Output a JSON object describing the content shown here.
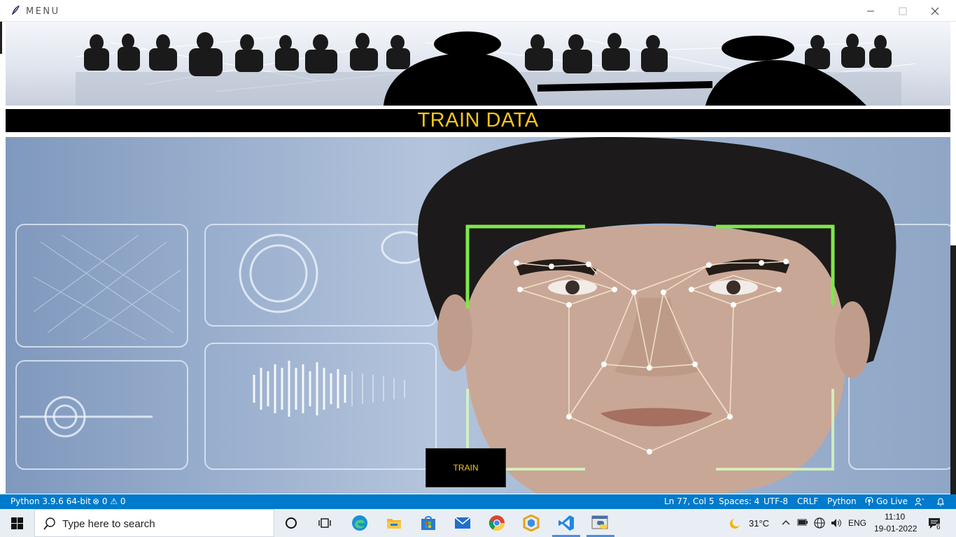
{
  "window": {
    "title": "MENU"
  },
  "header": {
    "title": "TRAIN DATA"
  },
  "main": {
    "train_button_label": "TRAIN"
  },
  "statusbar": {
    "python": "Python 3.9.6 64-bit",
    "problems": "⊗ 0 ⚠ 0",
    "cursor": "Ln 77, Col 5",
    "spaces": "Spaces: 4",
    "encoding": "UTF-8",
    "eol": "CRLF",
    "language": "Python",
    "golive": "Go Live"
  },
  "taskbar": {
    "search_placeholder": "Type here to search",
    "apps": [
      "task-view",
      "edge",
      "file-explorer",
      "microsoft-store",
      "mail",
      "chrome",
      "office",
      "vscode",
      "python-idle"
    ],
    "weather": "31°C",
    "language": "ENG",
    "time": "11:10",
    "date": "19-01-2022",
    "notification_count": "6"
  },
  "colors": {
    "accent_yellow": "#f5c518",
    "statusbar_blue": "#007acc",
    "taskbar_bg": "#e9eef4"
  }
}
